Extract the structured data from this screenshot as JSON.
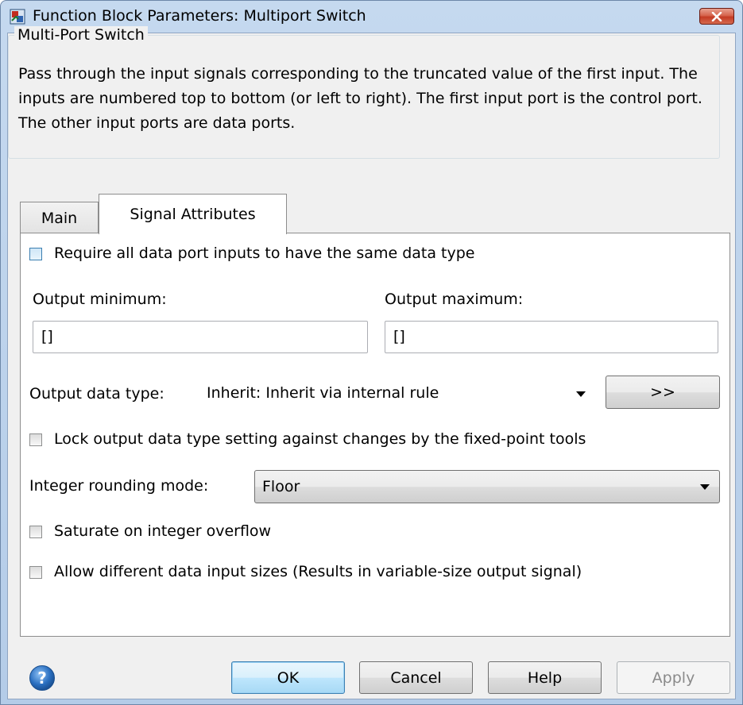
{
  "window": {
    "title": "Function Block Parameters: Multiport Switch"
  },
  "group": {
    "legend": "Multi-Port Switch",
    "description": "Pass through the input signals corresponding to the truncated value of the first input. The inputs are numbered top to bottom (or left to right). The first input port is the control port. The other input ports are data ports."
  },
  "tabs": [
    {
      "label": "Main",
      "active": false
    },
    {
      "label": "Signal Attributes",
      "active": true
    }
  ],
  "signal_attributes": {
    "require_same_type": {
      "label": "Require all data port inputs to have the same data type",
      "checked": false
    },
    "output_min": {
      "label": "Output minimum:",
      "value": "[]"
    },
    "output_max": {
      "label": "Output maximum:",
      "value": "[]"
    },
    "output_data_type": {
      "label": "Output data type:",
      "value": "Inherit: Inherit via internal rule",
      "assistant_button": ">>"
    },
    "lock_output": {
      "label": "Lock output data type setting against changes by the fixed-point tools",
      "checked": false
    },
    "rounding_mode": {
      "label": "Integer rounding mode:",
      "value": "Floor"
    },
    "saturate": {
      "label": "Saturate on integer overflow",
      "checked": false
    },
    "allow_sizes": {
      "label": "Allow different data input sizes (Results in variable-size output signal)",
      "checked": false
    }
  },
  "buttons": {
    "ok": "OK",
    "cancel": "Cancel",
    "help": "Help",
    "apply": "Apply"
  },
  "colors": {
    "title_bar": "#c5d9ef",
    "close_button": "#c43b23",
    "default_button": "#bee6fd",
    "help_icon": "#2a6fc0"
  }
}
